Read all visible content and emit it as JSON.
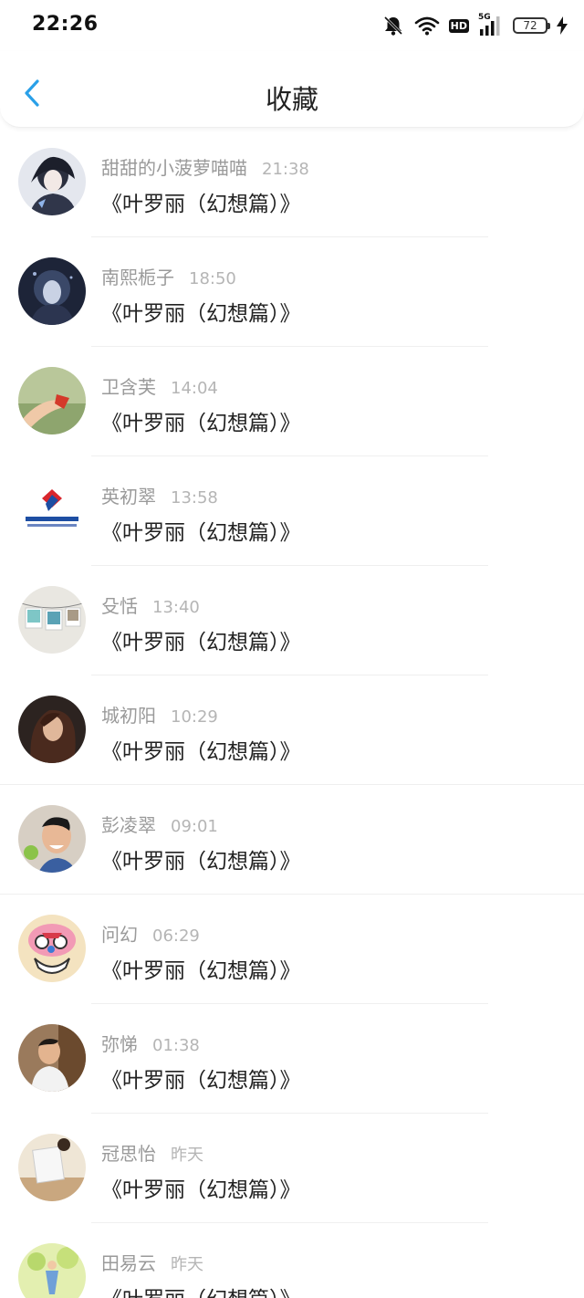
{
  "status_bar": {
    "time": "22:26",
    "battery": "72",
    "network": "5G",
    "hd": "HD"
  },
  "header": {
    "title": "收藏"
  },
  "items": [
    {
      "name": "甜甜的小菠萝喵喵",
      "time": "21:38",
      "content": "《叶罗丽（幻想篇）》"
    },
    {
      "name": "南熙栀子",
      "time": "18:50",
      "content": "《叶罗丽（幻想篇）》"
    },
    {
      "name": "卫含芙",
      "time": "14:04",
      "content": "《叶罗丽（幻想篇）》"
    },
    {
      "name": "英初翠",
      "time": "13:58",
      "content": "《叶罗丽（幻想篇）》"
    },
    {
      "name": "殳恬",
      "time": "13:40",
      "content": "《叶罗丽（幻想篇）》"
    },
    {
      "name": "城初阳",
      "time": "10:29",
      "content": "《叶罗丽（幻想篇）》"
    },
    {
      "name": "彭凌翠",
      "time": "09:01",
      "content": "《叶罗丽（幻想篇）》"
    },
    {
      "name": "问幻",
      "time": "06:29",
      "content": "《叶罗丽（幻想篇）》"
    },
    {
      "name": "弥悌",
      "time": "01:38",
      "content": "《叶罗丽（幻想篇）》"
    },
    {
      "name": "冠思怡",
      "time": "昨天",
      "content": "《叶罗丽（幻想篇）》"
    },
    {
      "name": "田易云",
      "time": "昨天",
      "content": "《叶罗丽（幻想篇）》"
    }
  ],
  "colors": {
    "accent": "#2aa0e8",
    "name_text": "#9a9a9a",
    "time_text": "#b5b5b5",
    "content_text": "#222222"
  },
  "icons": {
    "back": "chevron-left-icon",
    "silent": "bell-off-icon",
    "wifi": "wifi-icon",
    "signal": "cell-signal-icon",
    "charging": "lightning-icon"
  }
}
